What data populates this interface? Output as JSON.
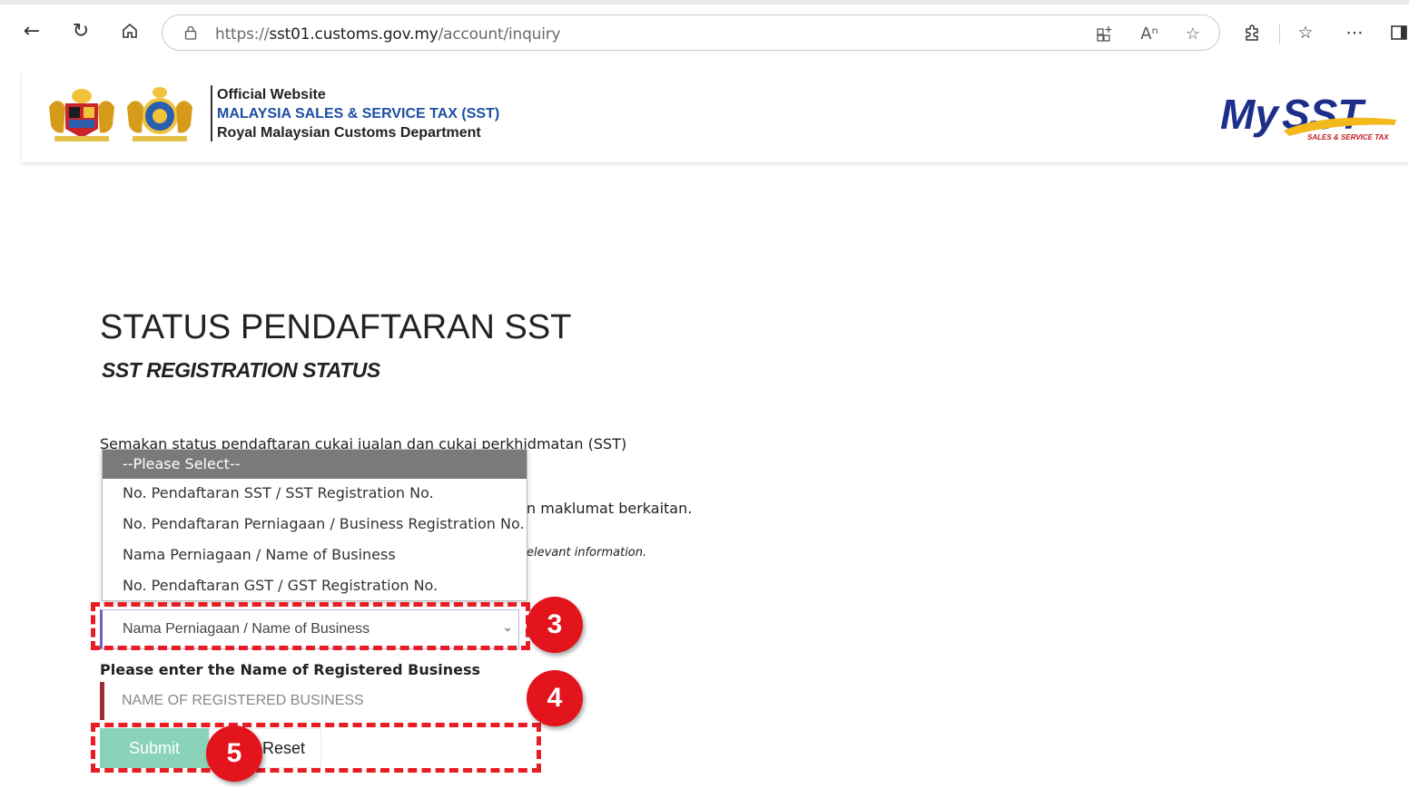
{
  "browser": {
    "url_prefix": "https://",
    "url_host": "sst01.customs.gov.my",
    "url_path": "/account/inquiry",
    "icons": {
      "back": "back-arrow-icon",
      "refresh": "refresh-icon",
      "home": "home-icon",
      "lock": "lock-icon",
      "apps": "add-app-icon",
      "read_aloud": "read-aloud-icon",
      "favorite": "favorite-star-icon",
      "extensions": "extensions-icon",
      "favorites": "favorites-list-icon",
      "more": "more-icon",
      "sidebar": "sidebar-icon"
    }
  },
  "header": {
    "line1": "Official Website",
    "line2": "MALAYSIA SALES & SERVICE TAX (SST)",
    "line3": "Royal Malaysian Customs Department",
    "logo_primary": "My",
    "logo_secondary": "SST",
    "logo_tag": "SALES & SERVICE TAX",
    "accent_color": "#1d4fa3"
  },
  "page": {
    "title": "STATUS PENDAFTARAN SST",
    "subtitle": "SST REGISTRATION STATUS",
    "desc_line1": "Semakan status pendaftaran cukai jualan dan cukai perkhidmatan (SST)",
    "desc_line2_tail": "n maklumat berkaitan.",
    "desc_line3_tail": "elevant information."
  },
  "dropdown": {
    "placeholder": "--Please Select--",
    "options": [
      "No. Pendaftaran SST / SST Registration No.",
      "No. Pendaftaran Perniagaan / Business Registration No.",
      "Nama Perniagaan / Name of Business",
      "No. Pendaftaran GST / GST Registration No."
    ],
    "selected": "Nama Perniagaan / Name of Business"
  },
  "form": {
    "field_label": "Please enter the Name of Registered Business",
    "input_value": "",
    "input_placeholder": "NAME OF REGISTERED BUSINESS",
    "submit_label": "Submit",
    "reset_label": "Reset",
    "submit_color": "#8ad3b9"
  },
  "annotations": {
    "step3": "3",
    "step4": "4",
    "step5": "5",
    "color": "#e3141b"
  }
}
